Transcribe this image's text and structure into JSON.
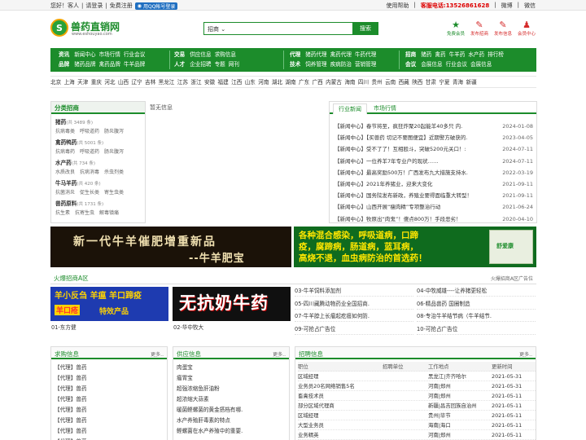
{
  "topbar": {
    "greeting": "您好！客人",
    "login": "请登录",
    "register": "免费注册",
    "qq_login": "用QQ帐号登录",
    "help": "使用帮助",
    "hotline": "客服电话:13526861628",
    "weibo": "微博",
    "weixin": "微信"
  },
  "header": {
    "logo_char": "S",
    "logo_text": "兽药直销网",
    "logo_url": "www.eshouyao.com",
    "search_select": "招商",
    "search_button": "搜索",
    "icons": [
      {
        "label": "免费会员",
        "glyph": "★",
        "color": "green"
      },
      {
        "label": "发布招商",
        "glyph": "✎",
        "color": "red"
      },
      {
        "label": "发布信息",
        "glyph": "✎",
        "color": "red"
      },
      {
        "label": "会员中心",
        "glyph": "♟",
        "color": "red"
      }
    ]
  },
  "nav": {
    "groups": [
      {
        "row1": [
          "资讯",
          "新闻中心",
          "市场行情",
          "行业会议"
        ],
        "row2": [
          "品牌",
          "猪药品牌",
          "禽药品牌",
          "牛羊品牌"
        ]
      },
      {
        "row1": [
          "交易",
          "供应信息",
          "求购信息"
        ],
        "row2": [
          "人才",
          "企业招聘",
          "专题",
          "网刊"
        ]
      },
      {
        "row1": [
          "代理",
          "猪药代理",
          "禽药代理",
          "牛药代理"
        ],
        "row2": [
          "技术",
          "饲养管理",
          "疾病防治",
          "营销管理"
        ]
      },
      {
        "row1": [
          "招商",
          "猪药",
          "禽药",
          "牛羊药",
          "水产药",
          "排行榜"
        ],
        "row2": [
          "会议",
          "会展信息",
          "行业会议",
          "会展信息"
        ]
      }
    ]
  },
  "regions": [
    "北京",
    "上海",
    "天津",
    "重庆",
    "河北",
    "山西",
    "辽宁",
    "吉林",
    "黑龙江",
    "江苏",
    "浙江",
    "安徽",
    "福建",
    "江西",
    "山东",
    "河南",
    "湖北",
    "湖南",
    "广东",
    "广西",
    "内蒙古",
    "海南",
    "四川",
    "贵州",
    "云南",
    "西藏",
    "陕西",
    "甘肃",
    "宁夏",
    "青海",
    "新疆"
  ],
  "category": {
    "title": "分类招商",
    "items": [
      {
        "name": "猪药",
        "count": "(共 3489 条)",
        "subs": [
          "抗病毒类",
          "呼吸道药",
          "肠炎腹泻"
        ]
      },
      {
        "name": "禽药鸭药",
        "count": "(共 5001 条)",
        "subs": [
          "抗病毒药",
          "呼吸道药",
          "肠炎腹泻"
        ]
      },
      {
        "name": "水产药",
        "count": "(共 734 条)",
        "subs": [
          "水质改良",
          "抗病消毒",
          "杀虫剂类"
        ]
      },
      {
        "name": "牛马羊药",
        "count": "(共 420 条)",
        "subs": [
          "抗菌消炎",
          "促生长类",
          "寄生虫类"
        ]
      },
      {
        "name": "兽药原料",
        "count": "(共 1731 条)",
        "subs": [
          "抗生素",
          "抗寄生虫",
          "解毒镇痛"
        ]
      }
    ]
  },
  "no_info": "暂无信息",
  "news": {
    "tabs": [
      "行业新闻",
      "市场行情"
    ],
    "rows": [
      {
        "title": "【新闻中心】春节将至，疯狂炸聚20起能羊40多只 内.",
        "date": "2024-01-08"
      },
      {
        "title": "【新闻中心】【买兽药 切记不要图便宜】近期警方破获的.",
        "date": "2023-04-05"
      },
      {
        "title": "【新闻中心】受不了了！互相殴斗，突破5200元关口！:",
        "date": "2024-07-11"
      },
      {
        "title": "【新闻中心】一位养羊7年专业户的现状……",
        "date": "2024-07-11"
      },
      {
        "title": "【新闻中心】最高奖励500万！广西发布九大措施支持水.",
        "date": "2022-03-19"
      },
      {
        "title": "【新闻中心】2021年养猪业，迎来大变化",
        "date": "2021-09-11"
      },
      {
        "title": "【新闻中心】国务院发布新政，养殖业要得面临重大转型！",
        "date": "2021-09-11"
      },
      {
        "title": "【新闻中心】山西开展“瘦肉精”专项整治行动",
        "date": "2021-06-24"
      },
      {
        "title": "【新闻中心】牧原出“肉鬼”！傻点800万！手段恶劣！",
        "date": "2020-04-10"
      }
    ]
  },
  "banners": {
    "b1_line1": "新一代牛羊催肥增重新品",
    "b1_line2": "--牛羊肥宝",
    "b2_lines": [
      "各种混合感染，呼吸道病，口蹄",
      "疫，腐蹄病，肠道病，蓝耳病，",
      "高烧不退，血虫病防治的首选药！"
    ],
    "b2_box": "舒爱康"
  },
  "fire": {
    "title": "火爆招商A区",
    "right": "火爆招商A区广告位",
    "ad1_lines": [
      "羊小反刍 羊瘟 羊口蹄疫",
      "羊口疮",
      "特效产品"
    ],
    "ad2_text": "无抗奶牛药",
    "captions": [
      "01-东方健",
      "02-华中牧大"
    ],
    "cells": [
      "03-牛羊饲料添加剂",
      "04-中牧威雄----让养猪更轻松",
      "05-四川藏腾动物药业全国招商.",
      "06-精品兽药 国圈制造",
      "07-牛羊脖上长瘤起疙瘩如何防.",
      "08-专治牛羊结节病（牛羊结节.",
      "09-可抢占广告位",
      "10-可抢占广告位"
    ]
  },
  "buy": {
    "title": "求购信息",
    "more": "更多..",
    "rows": [
      "【代理】兽药",
      "【代理】兽药",
      "【代理】兽药",
      "【代理】兽药",
      "【代理】兽药",
      "【代理】兽药",
      "【代理】兽药",
      "【代理】兽药"
    ]
  },
  "supply": {
    "title": "供应信息",
    "more": "更多..",
    "rows": [
      "肉蛋宝",
      "瘤胃宝",
      "超强浓缩鱼肝油粉",
      "超浓缩大蒜素",
      "暖菌鲣螺菌的黄金搭档有哪.",
      "水产养殖肝毒素的特点",
      "鲣螺菌在水产养殖中的重要."
    ]
  },
  "jobs": {
    "title": "招聘信息",
    "more": "更多..",
    "headers": [
      "职位",
      "招聘单位",
      "工作地点",
      "更新时间"
    ],
    "rows": [
      {
        "job": "区域经理",
        "place": "黑龙江|齐齐哈尔",
        "date": "2021-05-31"
      },
      {
        "job": "业务员20名网络销售5名",
        "place": "河南|郑州",
        "date": "2021-05-31"
      },
      {
        "job": "畜禽技术员",
        "place": "河南|郑州",
        "date": "2021-05-11"
      },
      {
        "job": "部分区域代理商",
        "place": "新疆|昌吉回族自治州",
        "date": "2021-05-11"
      },
      {
        "job": "区域经理",
        "place": "贵州|毕节",
        "date": "2021-05-11"
      },
      {
        "job": "大型业务员",
        "place": "海南|海口",
        "date": "2021-05-11"
      },
      {
        "job": "业务精英",
        "place": "河南|郑州",
        "date": "2021-05-11"
      }
    ]
  }
}
